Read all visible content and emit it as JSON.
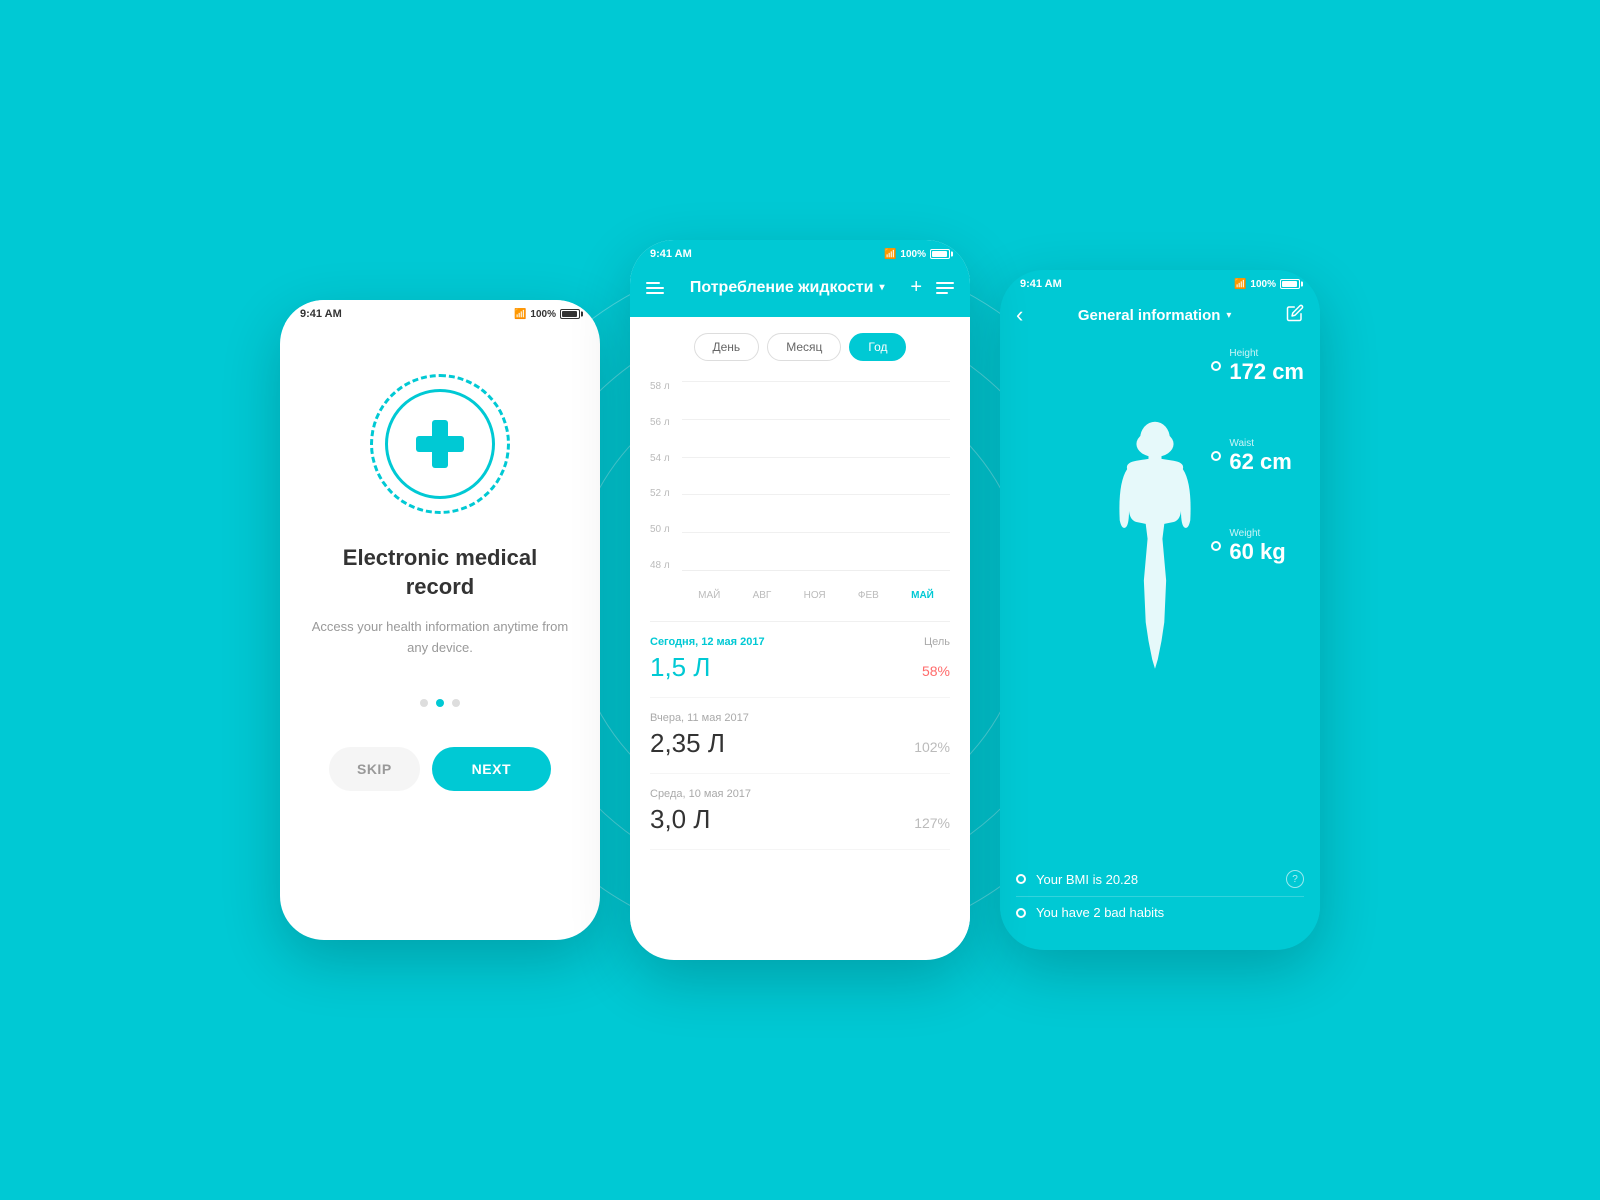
{
  "background_color": "#00C9D4",
  "phone1": {
    "status_time": "9:41 AM",
    "status_wifi": "100%",
    "title": "Electronic medical record",
    "description": "Access your health information anytime from any device.",
    "dots": [
      "inactive",
      "active",
      "inactive"
    ],
    "btn_skip": "SKIP",
    "btn_next": "NEXT"
  },
  "phone2": {
    "status_time": "9:41 AM",
    "status_wifi": "100%",
    "nav_title": "Потребление жидкости",
    "tabs": [
      {
        "label": "День",
        "active": false
      },
      {
        "label": "Месяц",
        "active": false
      },
      {
        "label": "Год",
        "active": true
      }
    ],
    "chart": {
      "y_labels": [
        "58 л",
        "56 л",
        "54 л",
        "52 л",
        "50 л",
        "48 л"
      ],
      "x_labels": [
        "МАЙ",
        "АВГ",
        "НОЯ",
        "ФЕВ",
        "МАЙ"
      ]
    },
    "entries": [
      {
        "date": "Сегодня, 12 мая 2017",
        "goal_label": "Цель",
        "value": "1,5 Л",
        "percent": "58%",
        "is_today": true,
        "warn": true
      },
      {
        "date": "Вчера, 11 мая 2017",
        "value": "2,35 Л",
        "percent": "102%",
        "is_today": false,
        "warn": false
      },
      {
        "date": "Среда, 10 мая 2017",
        "value": "3,0 Л",
        "percent": "127%",
        "is_today": false,
        "warn": false
      }
    ]
  },
  "phone3": {
    "status_time": "9:41 AM",
    "status_wifi": "100%",
    "header_title": "General information",
    "measurements": [
      {
        "label": "Height",
        "value": "172 cm"
      },
      {
        "label": "Waist",
        "value": "62 cm"
      },
      {
        "label": "Weight",
        "value": "60 kg"
      }
    ],
    "info_rows": [
      {
        "text": "Your BMI is 20.28",
        "has_help": true
      },
      {
        "text": "You have 2 bad habits",
        "has_help": false
      }
    ]
  }
}
